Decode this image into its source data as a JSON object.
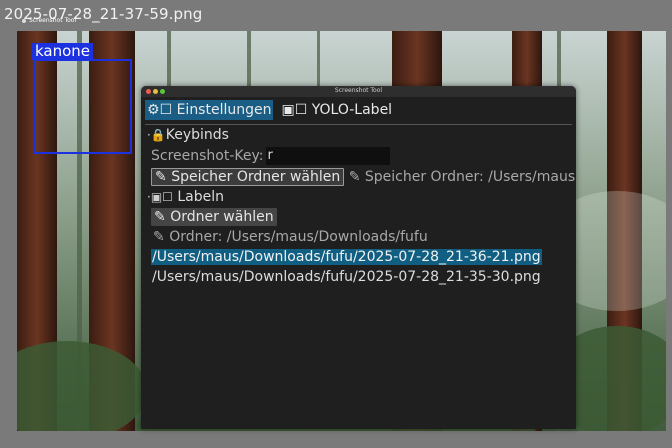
{
  "frame": {
    "title": "2025-07-28_21-37-59.png"
  },
  "mini_title": "Screenshot Tool",
  "annotation": {
    "label": "kanone",
    "color": "#1c32e0"
  },
  "window": {
    "title": "Screenshot Tool",
    "tabs": [
      {
        "icon": "gear-icon",
        "glyph": "⚙",
        "box": "☐",
        "label": "Einstellungen",
        "active": true
      },
      {
        "icon": "image-icon",
        "glyph": "▣",
        "box": "☐",
        "label": "YOLO-Label",
        "active": false
      }
    ],
    "keybinds": {
      "header": "Keybinds",
      "key_label": "Screenshot-Key:",
      "key_value": "r"
    },
    "save_folder": {
      "button": "Speicher Ordner wählen",
      "path_label": "Speicher Ordner: /Users/maus"
    },
    "labeln": {
      "header": "Labeln",
      "button": "Ordner wählen",
      "path_label": "Ordner: /Users/maus/Downloads/fufu"
    },
    "files": [
      {
        "path": "/Users/maus/Downloads/fufu/2025-07-28_21-36-21.png",
        "selected": true
      },
      {
        "path": "/Users/maus/Downloads/fufu/2025-07-28_21-35-30.png",
        "selected": false
      }
    ]
  },
  "colors": {
    "accent": "#1a5e86",
    "selection": "#105f82",
    "bbox": "#1c32e0",
    "window_bg": "#1f1f1f"
  }
}
